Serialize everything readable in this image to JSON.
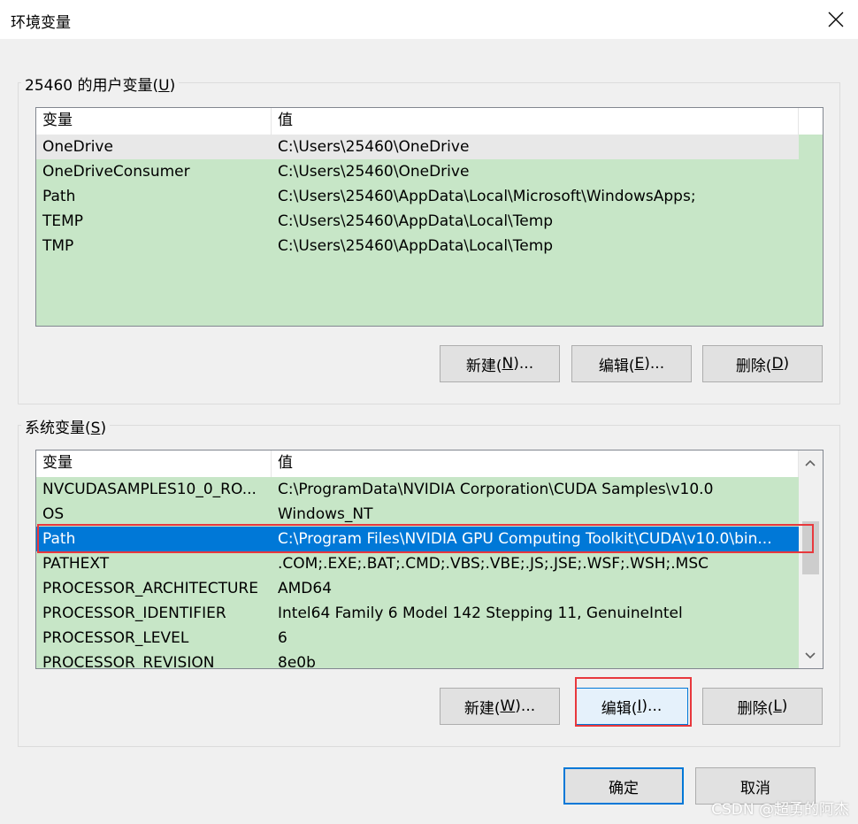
{
  "window": {
    "title": "环境变量",
    "close_glyph": "✕"
  },
  "user_vars": {
    "group_label_prefix": "25460 的用户变量(",
    "group_label_key": "U",
    "group_label_suffix": ")",
    "columns": [
      "变量",
      "值"
    ],
    "rows": [
      {
        "name": "OneDrive",
        "value": "C:\\Users\\25460\\OneDrive"
      },
      {
        "name": "OneDriveConsumer",
        "value": "C:\\Users\\25460\\OneDrive"
      },
      {
        "name": "Path",
        "value": "C:\\Users\\25460\\AppData\\Local\\Microsoft\\WindowsApps;"
      },
      {
        "name": "TEMP",
        "value": "C:\\Users\\25460\\AppData\\Local\\Temp"
      },
      {
        "name": "TMP",
        "value": "C:\\Users\\25460\\AppData\\Local\\Temp"
      }
    ],
    "buttons": {
      "new_prefix": "新建(",
      "new_key": "N",
      "new_suffix": ")...",
      "edit_prefix": "编辑(",
      "edit_key": "E",
      "edit_suffix": ")...",
      "delete_prefix": "删除(",
      "delete_key": "D",
      "delete_suffix": ")"
    }
  },
  "system_vars": {
    "group_label_prefix": "系统变量(",
    "group_label_key": "S",
    "group_label_suffix": ")",
    "columns": [
      "变量",
      "值"
    ],
    "rows": [
      {
        "name": "NVCUDASAMPLES10_0_RO...",
        "value": "C:\\ProgramData\\NVIDIA Corporation\\CUDA Samples\\v10.0"
      },
      {
        "name": "OS",
        "value": "Windows_NT"
      },
      {
        "name": "Path",
        "value": "C:\\Program Files\\NVIDIA GPU Computing Toolkit\\CUDA\\v10.0\\bin..."
      },
      {
        "name": "PATHEXT",
        "value": ".COM;.EXE;.BAT;.CMD;.VBS;.VBE;.JS;.JSE;.WSF;.WSH;.MSC"
      },
      {
        "name": "PROCESSOR_ARCHITECTURE",
        "value": "AMD64"
      },
      {
        "name": "PROCESSOR_IDENTIFIER",
        "value": "Intel64 Family 6 Model 142 Stepping 11, GenuineIntel"
      },
      {
        "name": "PROCESSOR_LEVEL",
        "value": "6"
      },
      {
        "name": "PROCESSOR_REVISION",
        "value": "8e0b"
      }
    ],
    "buttons": {
      "new_prefix": "新建(",
      "new_key": "W",
      "new_suffix": ")...",
      "edit_prefix": "编辑(",
      "edit_key": "I",
      "edit_suffix": ")...",
      "delete_prefix": "删除(",
      "delete_key": "L",
      "delete_suffix": ")"
    }
  },
  "footer": {
    "ok_label": "确定",
    "cancel_label": "取消"
  },
  "watermark": "CSDN @超勇的阿杰",
  "colors": {
    "list_bg": "#c7e6c7",
    "selection": "#0078d7",
    "highlight_box": "#e8383d"
  }
}
